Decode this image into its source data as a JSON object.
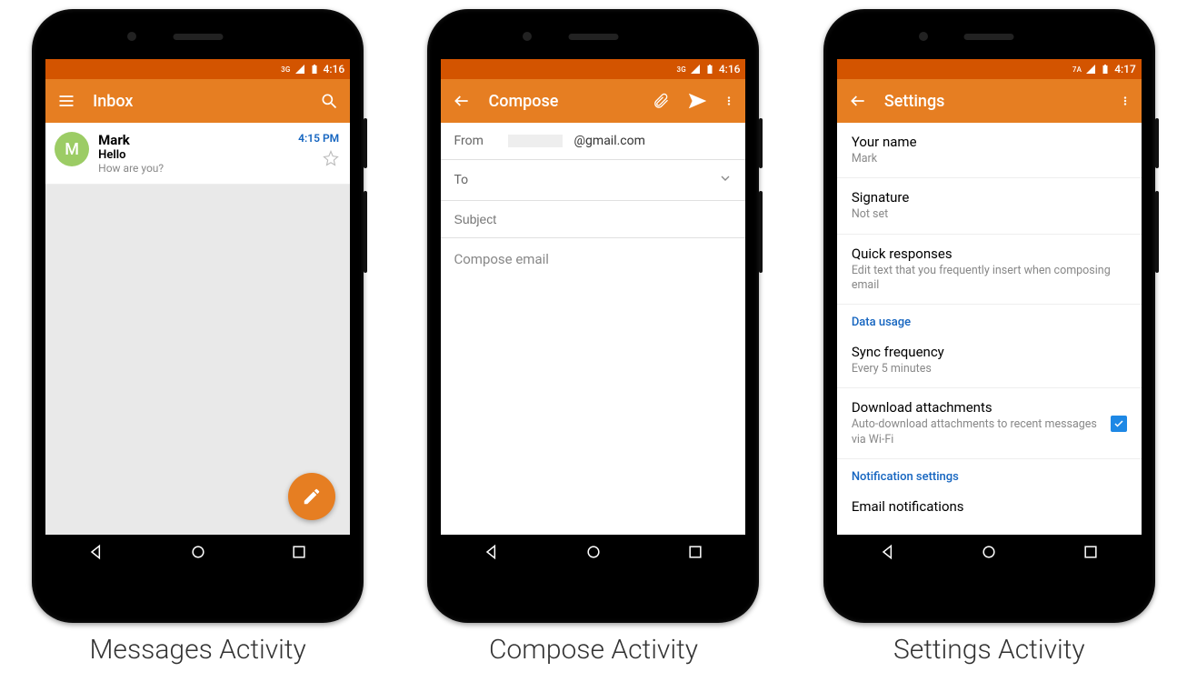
{
  "captions": {
    "messages": "Messages Activity",
    "compose": "Compose Activity",
    "settings": "Settings Activity"
  },
  "status": {
    "net_label_36": "3G",
    "net_label_7a": "7A",
    "time_416": "4:16",
    "time_417": "4:17"
  },
  "inbox": {
    "title": "Inbox",
    "msg": {
      "avatar_letter": "M",
      "sender": "Mark",
      "subject": "Hello",
      "preview": "How are you?",
      "time": "4:15 PM"
    }
  },
  "compose": {
    "title": "Compose",
    "from_label": "From",
    "from_value": "@gmail.com",
    "to_label": "To",
    "subject_placeholder": "Subject",
    "body_placeholder": "Compose email"
  },
  "settings": {
    "title": "Settings",
    "name_label": "Your name",
    "name_value": "Mark",
    "sig_label": "Signature",
    "sig_value": "Not set",
    "quick_label": "Quick responses",
    "quick_sub": "Edit text that you frequently insert when composing email",
    "data_header": "Data usage",
    "sync_label": "Sync frequency",
    "sync_value": "Every 5 minutes",
    "dl_label": "Download attachments",
    "dl_sub": "Auto-download attachments to recent messages via Wi-Fi",
    "notif_header": "Notification settings",
    "email_notif_label": "Email notifications"
  }
}
